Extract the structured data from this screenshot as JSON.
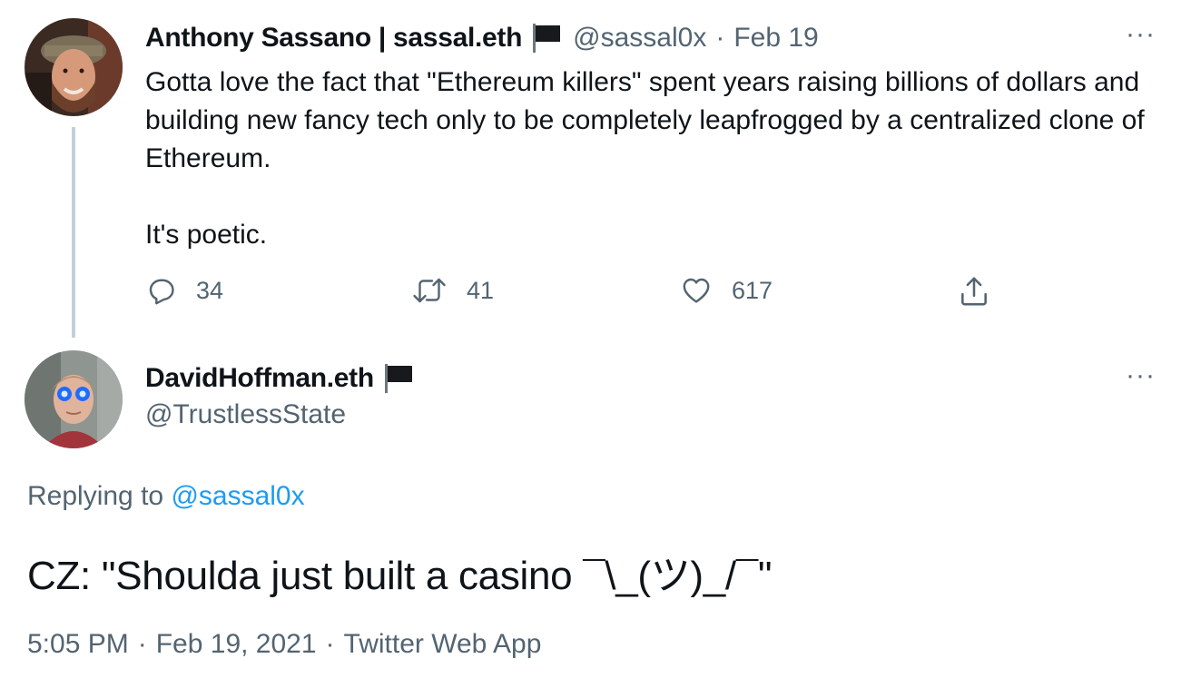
{
  "tweet1": {
    "author_name": "Anthony Sassano | sassal.eth",
    "flag_icon": "black-flag-icon",
    "handle": "@sassal0x",
    "separator": "·",
    "date": "Feb 19",
    "text_line1": "Gotta love the fact that \"Ethereum killers\" spent years raising billions of dollars and building new fancy tech only to be completely leapfrogged by a centralized clone of Ethereum.",
    "text_line2": "It's poetic.",
    "more_label": "···",
    "actions": {
      "reply_count": "34",
      "retweet_count": "41",
      "like_count": "617"
    }
  },
  "tweet2": {
    "author_name": "DavidHoffman.eth",
    "flag_icon": "black-flag-icon",
    "handle": "@TrustlessState",
    "more_label": "···",
    "replying_prefix": "Replying to",
    "replying_to": "@sassal0x",
    "text": "CZ: \"Shoulda just built a casino ¯\\_(ツ)_/¯\"",
    "time": "5:05 PM",
    "meta_separator": "·",
    "date": "Feb 19, 2021",
    "source": "Twitter Web App"
  },
  "colors": {
    "text": "#0f1419",
    "muted": "#536471",
    "link": "#1d9bf0",
    "thread_line": "#c4cfd6"
  }
}
